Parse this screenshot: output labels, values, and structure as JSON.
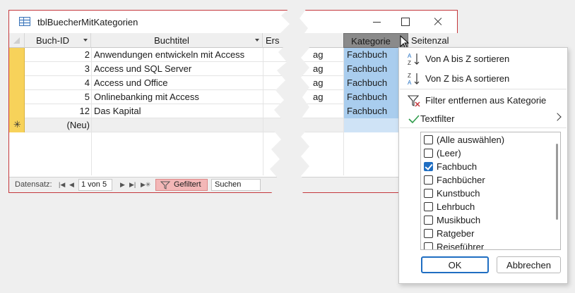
{
  "window": {
    "title": "tblBuecherMitKategorien"
  },
  "columns": {
    "buch_id": "Buch-ID",
    "buchtitel": "Buchtitel",
    "ersch": "Ers",
    "kategorie": "Kategorie",
    "seitenzahl": "Seitenzal"
  },
  "rows": [
    {
      "id": "2",
      "title": "Anwendungen entwickeln mit Access",
      "ersch": "ag",
      "kategorie": "Fachbuch"
    },
    {
      "id": "3",
      "title": "Access und SQL Server",
      "ersch": "ag",
      "kategorie": "Fachbuch"
    },
    {
      "id": "4",
      "title": "Access und Office",
      "ersch": "ag",
      "kategorie": "Fachbuch"
    },
    {
      "id": "5",
      "title": "Onlinebanking mit Access",
      "ersch": "ag",
      "kategorie": "Fachbuch"
    },
    {
      "id": "12",
      "title": "Das Kapital",
      "ersch": "",
      "kategorie": "Fachbuch"
    }
  ],
  "new_row": {
    "id": "(Neu)"
  },
  "navbar": {
    "label": "Datensatz:",
    "position": "1 von 5",
    "filter_label": "Gefiltert",
    "search_label": "Suchen"
  },
  "menu": {
    "sort_asc": "Von A bis Z sortieren",
    "sort_desc": "Von Z bis A sortieren",
    "remove_filter": "Filter entfernen aus Kategorie",
    "text_filter": "Textfilter",
    "values": [
      {
        "label": "(Alle auswählen)",
        "checked": false
      },
      {
        "label": "(Leer)",
        "checked": false
      },
      {
        "label": "Fachbuch",
        "checked": true
      },
      {
        "label": "Fachbücher",
        "checked": false
      },
      {
        "label": "Kunstbuch",
        "checked": false
      },
      {
        "label": "Lehrbuch",
        "checked": false
      },
      {
        "label": "Musikbuch",
        "checked": false
      },
      {
        "label": "Ratgeber",
        "checked": false
      },
      {
        "label": "Reiseführer",
        "checked": false
      }
    ],
    "ok": "OK",
    "cancel": "Abbrechen"
  },
  "colors": {
    "accent_red": "#c4373c",
    "selected_blue": "#a9cdee",
    "record_selector": "#f7d25a",
    "check_blue": "#1f6ec2"
  }
}
